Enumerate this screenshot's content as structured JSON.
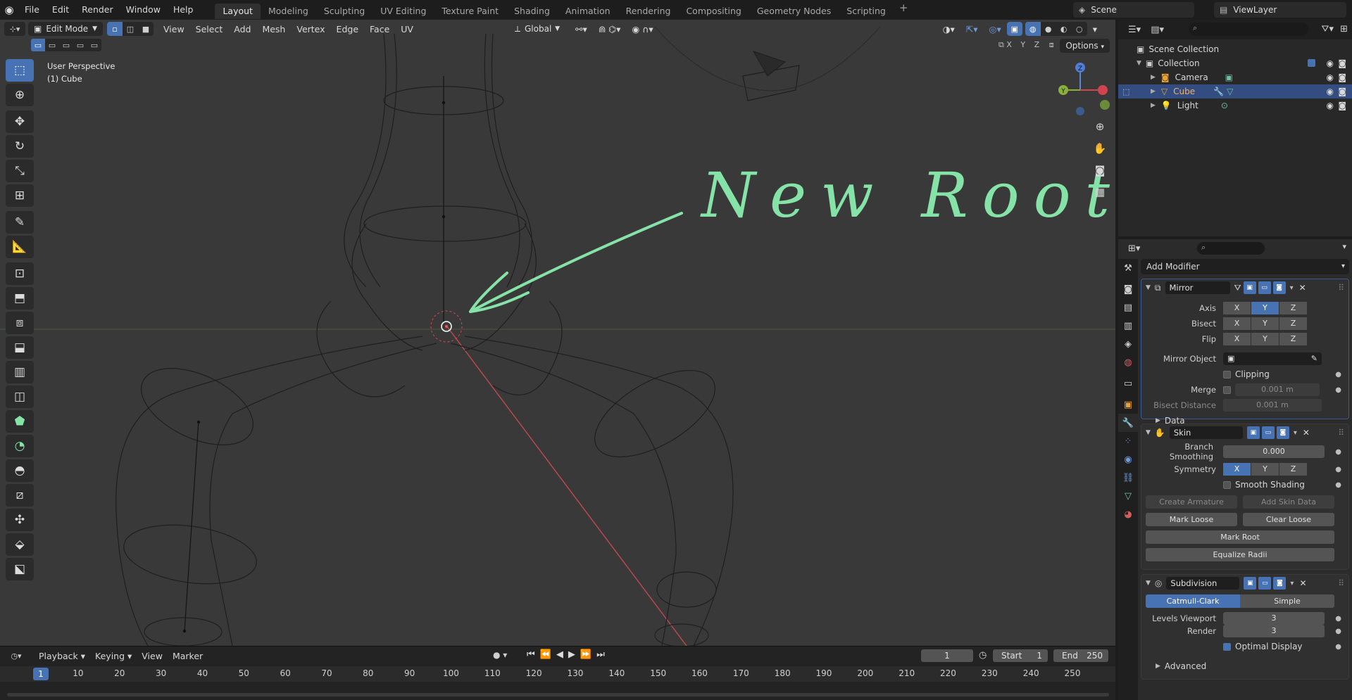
{
  "top_menu": [
    "File",
    "Edit",
    "Render",
    "Window",
    "Help"
  ],
  "workspace_tabs": [
    "Layout",
    "Modeling",
    "Sculpting",
    "UV Editing",
    "Texture Paint",
    "Shading",
    "Animation",
    "Rendering",
    "Compositing",
    "Geometry Nodes",
    "Scripting"
  ],
  "active_workspace": "Layout",
  "scene_name": "Scene",
  "view_layer": "ViewLayer",
  "viewport": {
    "mode": "Edit Mode",
    "menus": [
      "View",
      "Select",
      "Add",
      "Mesh",
      "Vertex",
      "Edge",
      "Face",
      "UV"
    ],
    "transform_orientation": "Global",
    "options_label": "Options",
    "axis_toggles": [
      "X",
      "Y",
      "Z"
    ],
    "info_line1": "User Perspective",
    "info_line2": "(1) Cube",
    "annotation": "New Root",
    "gizmo_labels": [
      "X",
      "Y",
      "Z"
    ]
  },
  "timeline": {
    "menus": [
      "Playback",
      "Keying",
      "View",
      "Marker"
    ],
    "current_frame": "1",
    "start_label": "Start",
    "start_value": "1",
    "end_label": "End",
    "end_value": "250",
    "ticks": [
      "1",
      "10",
      "20",
      "30",
      "40",
      "50",
      "60",
      "70",
      "80",
      "90",
      "100",
      "110",
      "120",
      "130",
      "140",
      "150",
      "160",
      "170",
      "180",
      "190",
      "200",
      "210",
      "220",
      "230",
      "240",
      "250"
    ]
  },
  "outliner": {
    "rows": [
      {
        "label": "Scene Collection"
      },
      {
        "label": "Collection"
      },
      {
        "label": "Camera"
      },
      {
        "label": "Cube"
      },
      {
        "label": "Light"
      }
    ]
  },
  "properties": {
    "add_modifier": "Add Modifier",
    "mirror": {
      "name": "Mirror",
      "axis_label": "Axis",
      "bisect_label": "Bisect",
      "flip_label": "Flip",
      "xyz": [
        "X",
        "Y",
        "Z"
      ],
      "mirror_object_label": "Mirror Object",
      "clipping_label": "Clipping",
      "merge_label": "Merge",
      "merge_value": "0.001 m",
      "bisect_distance_label": "Bisect Distance",
      "bisect_distance_value": "0.001 m",
      "data_label": "Data"
    },
    "skin": {
      "name": "Skin",
      "branch_smoothing_label": "Branch Smoothing",
      "branch_smoothing_value": "0.000",
      "symmetry_label": "Symmetry",
      "smooth_shading_label": "Smooth Shading",
      "create_armature": "Create Armature",
      "add_skin_data": "Add Skin Data",
      "mark_loose": "Mark Loose",
      "clear_loose": "Clear Loose",
      "mark_root": "Mark Root",
      "equalize_radii": "Equalize Radii"
    },
    "subdivision": {
      "name": "Subdivision",
      "catmull_clark": "Catmull-Clark",
      "simple": "Simple",
      "levels_viewport_label": "Levels Viewport",
      "levels_viewport_value": "3",
      "render_label": "Render",
      "render_value": "3",
      "optimal_display_label": "Optimal Display",
      "advanced_label": "Advanced"
    }
  },
  "colors": {
    "accent": "#4772b3",
    "annotation": "#86e3a8",
    "viewport_bg": "#393939",
    "x_axis": "#d1444f"
  }
}
